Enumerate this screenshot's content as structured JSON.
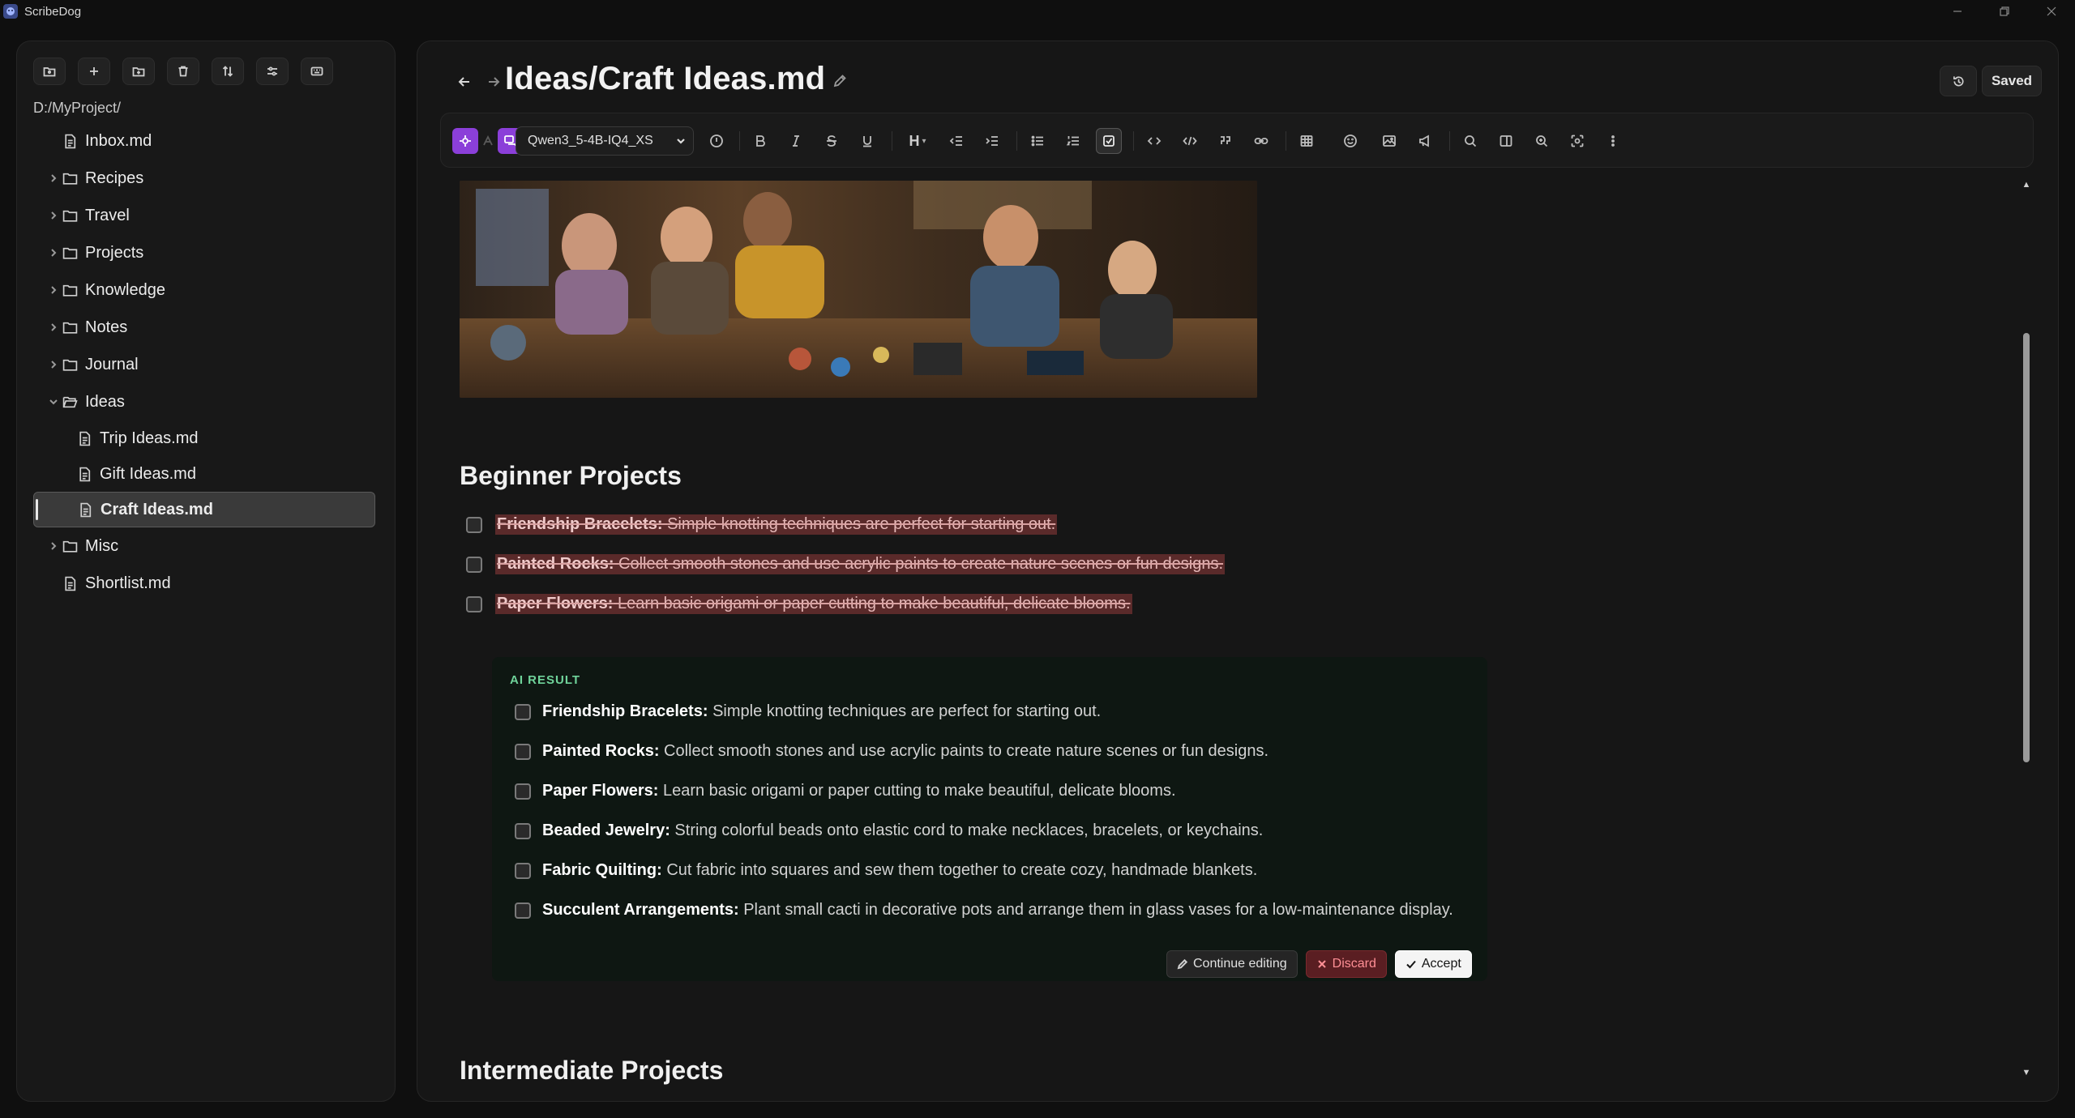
{
  "app": {
    "title": "ScribeDog"
  },
  "sidebar": {
    "path": "D:/MyProject/",
    "tree": [
      {
        "label": "Inbox.md",
        "type": "file"
      },
      {
        "label": "Recipes",
        "type": "folder"
      },
      {
        "label": "Travel",
        "type": "folder"
      },
      {
        "label": "Projects",
        "type": "folder"
      },
      {
        "label": "Knowledge",
        "type": "folder"
      },
      {
        "label": "Notes",
        "type": "folder"
      },
      {
        "label": "Journal",
        "type": "folder"
      },
      {
        "label": "Ideas",
        "type": "folder-open"
      },
      {
        "label": "Trip Ideas.md",
        "type": "file"
      },
      {
        "label": "Gift Ideas.md",
        "type": "file"
      },
      {
        "label": "Craft Ideas.md",
        "type": "file",
        "selected": true
      },
      {
        "label": "Misc",
        "type": "folder"
      },
      {
        "label": "Shortlist.md",
        "type": "file"
      }
    ]
  },
  "header": {
    "title": "Ideas/Craft Ideas.md",
    "saved_label": "Saved"
  },
  "toolbar": {
    "model": "Qwen3_5-4B-IQ4_XS",
    "heading_label": "H"
  },
  "content": {
    "heading1": "Beginner Projects",
    "original_tasks": [
      {
        "title": "Friendship Bracelets:",
        "desc": "Simple knotting techniques are perfect for starting out."
      },
      {
        "title": "Painted Rocks:",
        "desc": "Collect smooth stones and use acrylic paints to create nature scenes or fun designs."
      },
      {
        "title": "Paper Flowers:",
        "desc": "Learn basic origami or paper cutting to make beautiful, delicate blooms."
      }
    ],
    "ai_label": "AI RESULT",
    "ai_tasks": [
      {
        "title": "Friendship Bracelets:",
        "desc": "Simple knotting techniques are perfect for starting out."
      },
      {
        "title": "Painted Rocks:",
        "desc": "Collect smooth stones and use acrylic paints to create nature scenes or fun designs."
      },
      {
        "title": "Paper Flowers:",
        "desc": "Learn basic origami or paper cutting to make beautiful, delicate blooms."
      },
      {
        "title": "Beaded Jewelry:",
        "desc": "String colorful beads onto elastic cord to make necklaces, bracelets, or keychains."
      },
      {
        "title": "Fabric Quilting:",
        "desc": "Cut fabric into squares and sew them together to create cozy, handmade blankets."
      },
      {
        "title": "Succulent Arrangements:",
        "desc": "Plant small cacti in decorative pots and arrange them in glass vases for a low-maintenance display."
      }
    ],
    "actions": {
      "continue": "Continue editing",
      "discard": "Discard",
      "accept": "Accept"
    },
    "heading2": "Intermediate Projects"
  },
  "colors": {
    "accent_purple": "#8b3fd9",
    "ai_label_green": "#6fd39a",
    "discard_red": "#ff8f95",
    "deleted_bg": "#5a2a2a"
  }
}
